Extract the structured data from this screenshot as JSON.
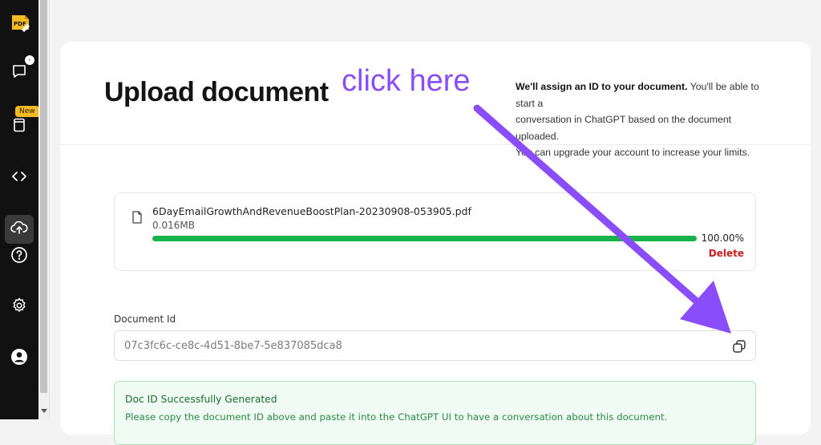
{
  "sidebar": {
    "logo": {
      "icon": "pdf-logo-icon",
      "text": "PDF"
    },
    "items": [
      {
        "name": "chat",
        "icon": "chat-bubble-icon",
        "badge": "-"
      },
      {
        "name": "library",
        "icon": "book-icon",
        "badge": "New"
      },
      {
        "name": "code",
        "icon": "code-brackets-icon"
      },
      {
        "name": "upload",
        "icon": "cloud-upload-icon",
        "active": true
      },
      {
        "name": "help",
        "icon": "help-circle-icon"
      },
      {
        "name": "settings",
        "icon": "gear-icon"
      },
      {
        "name": "account",
        "icon": "user-avatar-icon"
      }
    ]
  },
  "header": {
    "title": "Upload document",
    "annotation": "click here",
    "info_bold": "We'll assign an ID to your document.",
    "info_line1_rest": " You'll be able to start a",
    "info_line2": "conversation in ChatGPT based on the document uploaded.",
    "info_line3": "You can upgrade your account to increase your limits."
  },
  "upload": {
    "file_name": "6DayEmailGrowthAndRevenueBoostPlan-20230908-053905.pdf",
    "file_size": "0.016MB",
    "progress": 100,
    "progress_label": "100.00%",
    "delete_label": "Delete"
  },
  "doc_id": {
    "label": "Document Id",
    "value": "07c3fc6c-ce8c-4d51-8be7-5e837085dca8",
    "copy_icon": "copy-icon"
  },
  "success": {
    "title": "Doc ID Successfully Generated",
    "message": "Please copy the document ID above and paste it into the ChatGPT UI to have a conversation about this document."
  },
  "colors": {
    "accent_purple": "#8a4dfc",
    "progress_green": "#16b24a",
    "delete_red": "#c8201e",
    "sidebar_bg": "#111111",
    "badge_yellow": "#f5b922"
  }
}
